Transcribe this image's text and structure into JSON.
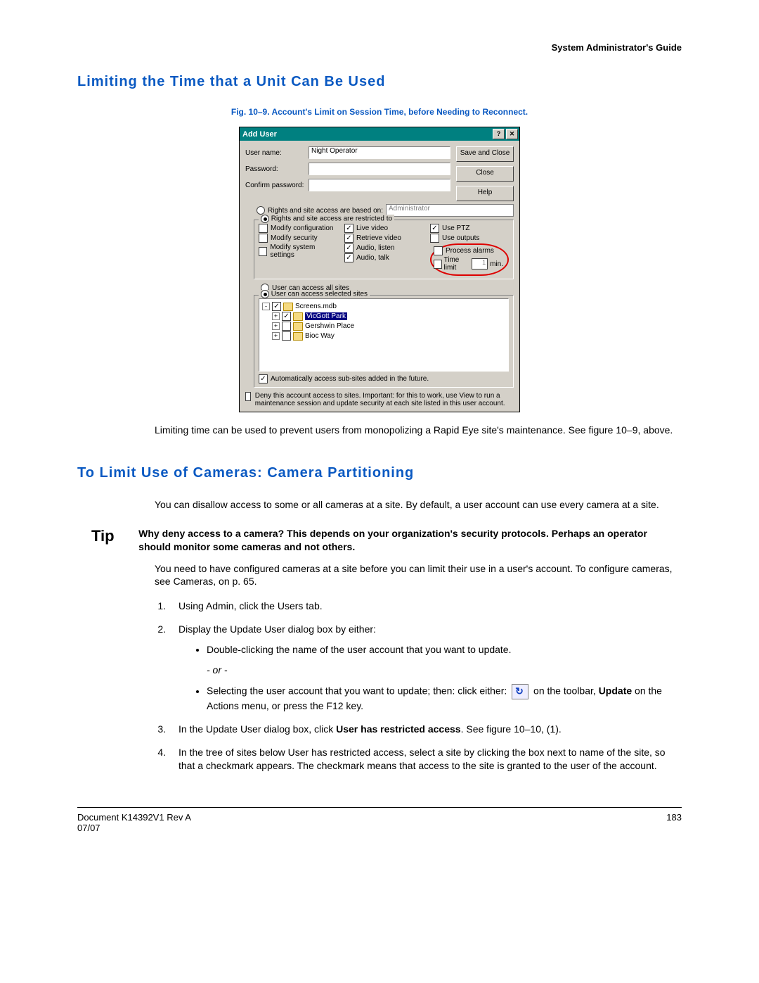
{
  "header": {
    "guide": "System Administrator's Guide"
  },
  "section1": {
    "title": "Limiting the Time that a Unit Can Be Used",
    "fig_caption": "Fig. 10–9.   Account's Limit on Session Time, before Needing to Reconnect.",
    "para": "Limiting time can be used to prevent users from monopolizing a Rapid Eye site's maintenance. See figure 10–9, above."
  },
  "dialog": {
    "title": "Add User",
    "help_btn": "?",
    "close_btn": "✕",
    "labels": {
      "username": "User name:",
      "password": "Password:",
      "confirm": "Confirm password:"
    },
    "username_value": "Night Operator",
    "buttons": {
      "save": "Save and Close",
      "close": "Close",
      "help": "Help"
    },
    "radio_based": "Rights and site access are based on:",
    "admin_value": "Administrator",
    "group_restricted": "Rights and site access are restricted to",
    "col1": {
      "modify_config": "Modify configuration",
      "modify_security": "Modify security",
      "modify_system": "Modify system settings"
    },
    "col2": {
      "live_video": "Live video",
      "retrieve_video": "Retrieve video",
      "audio_listen": "Audio, listen",
      "audio_talk": "Audio, talk"
    },
    "col3": {
      "use_ptz": "Use PTZ",
      "use_outputs": "Use outputs",
      "process_alarms": "Process alarms",
      "time_limit": "Time limit",
      "time_val": "1",
      "time_unit": "min."
    },
    "radio_all": "User can access all sites",
    "radio_selected": "User can access selected sites",
    "tree": {
      "root": "Screens.mdb",
      "n1": "VicGott Park",
      "n2": "Gershwin Place",
      "n3": "Bioc Way"
    },
    "auto_sub": "Automatically access sub-sites added in the future.",
    "deny": "Deny this account access to sites. Important: for this to work, use View to run a maintenance session and update security at each site listed in this user account."
  },
  "section2": {
    "title": "To Limit Use of Cameras: Camera Partitioning",
    "intro": "You can disallow access to some or all cameras at a site. By default, a user account can use every camera at a site.",
    "tip_label": "Tip",
    "tip_text": "Why deny access to a camera? This depends on your organization's security protocols. Perhaps an operator should monitor some cameras and not others.",
    "para2": "You need to have configured cameras at a site before you can limit their use in a user's account. To configure cameras, see Cameras, on p. 65.",
    "steps": {
      "s1": "Using Admin, click the Users tab.",
      "s2": "Display the Update User dialog box by either:",
      "s2a": "Double-clicking the name of the user account that you want to update.",
      "or": "- or -",
      "s2b_pre": "Selecting the user account that you want to update; then: click either:",
      "s2b_post": "on the toolbar, ",
      "s2b_bold": "Update",
      "s2b_end": " on the Actions menu, or press the F12 key.",
      "s3_pre": "In the Update User dialog box, click ",
      "s3_bold": "User has restricted access",
      "s3_post": ". See figure 10–10, (1).",
      "s4": "In the tree of sites below User has restricted access, select a site by clicking the box next to name of the site, so that a checkmark appears. The checkmark means that access to the site is granted to the user of the account."
    }
  },
  "footer": {
    "doc": "Document K14392V1 Rev A",
    "date": "07/07",
    "page": "183"
  }
}
